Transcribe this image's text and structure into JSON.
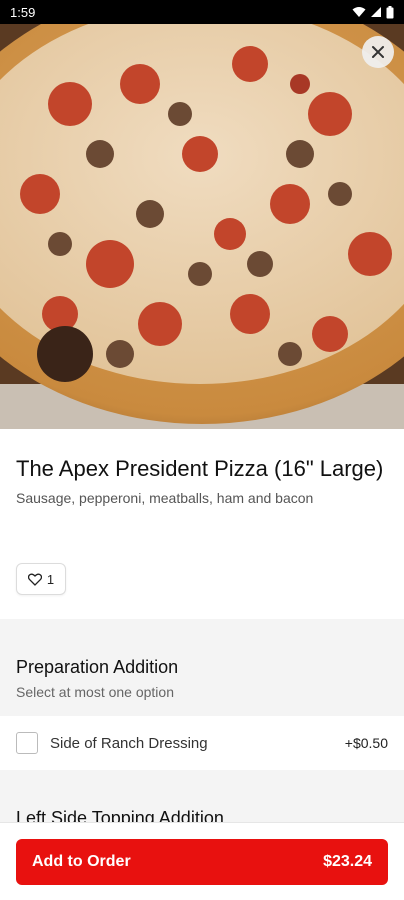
{
  "status_bar": {
    "time": "1:59"
  },
  "hero": {
    "image_alt": "Pizza photo",
    "close_icon": "close-icon"
  },
  "item": {
    "title": "The Apex President Pizza (16\" Large)",
    "description": "Sausage, pepperoni, meatballs, ham and bacon",
    "like_count": "1"
  },
  "preparation": {
    "title": "Preparation Addition",
    "subtitle": "Select at most one option",
    "options": [
      {
        "label": "Side of Ranch Dressing",
        "price": "+$0.50",
        "checked": false
      }
    ]
  },
  "next_section": {
    "title": "Left Side Topping Addition"
  },
  "cta": {
    "label": "Add to Order",
    "price": "$23.24"
  },
  "colors": {
    "accent": "#e8110f",
    "section_bg": "#f4f4f4"
  }
}
